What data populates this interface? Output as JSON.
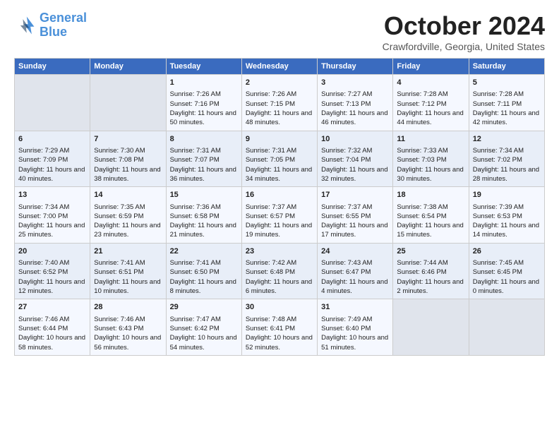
{
  "header": {
    "logo_line1": "General",
    "logo_line2": "Blue",
    "month": "October 2024",
    "location": "Crawfordville, Georgia, United States"
  },
  "days_of_week": [
    "Sunday",
    "Monday",
    "Tuesday",
    "Wednesday",
    "Thursday",
    "Friday",
    "Saturday"
  ],
  "weeks": [
    [
      {
        "day": "",
        "sunrise": "",
        "sunset": "",
        "daylight": ""
      },
      {
        "day": "",
        "sunrise": "",
        "sunset": "",
        "daylight": ""
      },
      {
        "day": "1",
        "sunrise": "Sunrise: 7:26 AM",
        "sunset": "Sunset: 7:16 PM",
        "daylight": "Daylight: 11 hours and 50 minutes."
      },
      {
        "day": "2",
        "sunrise": "Sunrise: 7:26 AM",
        "sunset": "Sunset: 7:15 PM",
        "daylight": "Daylight: 11 hours and 48 minutes."
      },
      {
        "day": "3",
        "sunrise": "Sunrise: 7:27 AM",
        "sunset": "Sunset: 7:13 PM",
        "daylight": "Daylight: 11 hours and 46 minutes."
      },
      {
        "day": "4",
        "sunrise": "Sunrise: 7:28 AM",
        "sunset": "Sunset: 7:12 PM",
        "daylight": "Daylight: 11 hours and 44 minutes."
      },
      {
        "day": "5",
        "sunrise": "Sunrise: 7:28 AM",
        "sunset": "Sunset: 7:11 PM",
        "daylight": "Daylight: 11 hours and 42 minutes."
      }
    ],
    [
      {
        "day": "6",
        "sunrise": "Sunrise: 7:29 AM",
        "sunset": "Sunset: 7:09 PM",
        "daylight": "Daylight: 11 hours and 40 minutes."
      },
      {
        "day": "7",
        "sunrise": "Sunrise: 7:30 AM",
        "sunset": "Sunset: 7:08 PM",
        "daylight": "Daylight: 11 hours and 38 minutes."
      },
      {
        "day": "8",
        "sunrise": "Sunrise: 7:31 AM",
        "sunset": "Sunset: 7:07 PM",
        "daylight": "Daylight: 11 hours and 36 minutes."
      },
      {
        "day": "9",
        "sunrise": "Sunrise: 7:31 AM",
        "sunset": "Sunset: 7:05 PM",
        "daylight": "Daylight: 11 hours and 34 minutes."
      },
      {
        "day": "10",
        "sunrise": "Sunrise: 7:32 AM",
        "sunset": "Sunset: 7:04 PM",
        "daylight": "Daylight: 11 hours and 32 minutes."
      },
      {
        "day": "11",
        "sunrise": "Sunrise: 7:33 AM",
        "sunset": "Sunset: 7:03 PM",
        "daylight": "Daylight: 11 hours and 30 minutes."
      },
      {
        "day": "12",
        "sunrise": "Sunrise: 7:34 AM",
        "sunset": "Sunset: 7:02 PM",
        "daylight": "Daylight: 11 hours and 28 minutes."
      }
    ],
    [
      {
        "day": "13",
        "sunrise": "Sunrise: 7:34 AM",
        "sunset": "Sunset: 7:00 PM",
        "daylight": "Daylight: 11 hours and 25 minutes."
      },
      {
        "day": "14",
        "sunrise": "Sunrise: 7:35 AM",
        "sunset": "Sunset: 6:59 PM",
        "daylight": "Daylight: 11 hours and 23 minutes."
      },
      {
        "day": "15",
        "sunrise": "Sunrise: 7:36 AM",
        "sunset": "Sunset: 6:58 PM",
        "daylight": "Daylight: 11 hours and 21 minutes."
      },
      {
        "day": "16",
        "sunrise": "Sunrise: 7:37 AM",
        "sunset": "Sunset: 6:57 PM",
        "daylight": "Daylight: 11 hours and 19 minutes."
      },
      {
        "day": "17",
        "sunrise": "Sunrise: 7:37 AM",
        "sunset": "Sunset: 6:55 PM",
        "daylight": "Daylight: 11 hours and 17 minutes."
      },
      {
        "day": "18",
        "sunrise": "Sunrise: 7:38 AM",
        "sunset": "Sunset: 6:54 PM",
        "daylight": "Daylight: 11 hours and 15 minutes."
      },
      {
        "day": "19",
        "sunrise": "Sunrise: 7:39 AM",
        "sunset": "Sunset: 6:53 PM",
        "daylight": "Daylight: 11 hours and 14 minutes."
      }
    ],
    [
      {
        "day": "20",
        "sunrise": "Sunrise: 7:40 AM",
        "sunset": "Sunset: 6:52 PM",
        "daylight": "Daylight: 11 hours and 12 minutes."
      },
      {
        "day": "21",
        "sunrise": "Sunrise: 7:41 AM",
        "sunset": "Sunset: 6:51 PM",
        "daylight": "Daylight: 11 hours and 10 minutes."
      },
      {
        "day": "22",
        "sunrise": "Sunrise: 7:41 AM",
        "sunset": "Sunset: 6:50 PM",
        "daylight": "Daylight: 11 hours and 8 minutes."
      },
      {
        "day": "23",
        "sunrise": "Sunrise: 7:42 AM",
        "sunset": "Sunset: 6:48 PM",
        "daylight": "Daylight: 11 hours and 6 minutes."
      },
      {
        "day": "24",
        "sunrise": "Sunrise: 7:43 AM",
        "sunset": "Sunset: 6:47 PM",
        "daylight": "Daylight: 11 hours and 4 minutes."
      },
      {
        "day": "25",
        "sunrise": "Sunrise: 7:44 AM",
        "sunset": "Sunset: 6:46 PM",
        "daylight": "Daylight: 11 hours and 2 minutes."
      },
      {
        "day": "26",
        "sunrise": "Sunrise: 7:45 AM",
        "sunset": "Sunset: 6:45 PM",
        "daylight": "Daylight: 11 hours and 0 minutes."
      }
    ],
    [
      {
        "day": "27",
        "sunrise": "Sunrise: 7:46 AM",
        "sunset": "Sunset: 6:44 PM",
        "daylight": "Daylight: 10 hours and 58 minutes."
      },
      {
        "day": "28",
        "sunrise": "Sunrise: 7:46 AM",
        "sunset": "Sunset: 6:43 PM",
        "daylight": "Daylight: 10 hours and 56 minutes."
      },
      {
        "day": "29",
        "sunrise": "Sunrise: 7:47 AM",
        "sunset": "Sunset: 6:42 PM",
        "daylight": "Daylight: 10 hours and 54 minutes."
      },
      {
        "day": "30",
        "sunrise": "Sunrise: 7:48 AM",
        "sunset": "Sunset: 6:41 PM",
        "daylight": "Daylight: 10 hours and 52 minutes."
      },
      {
        "day": "31",
        "sunrise": "Sunrise: 7:49 AM",
        "sunset": "Sunset: 6:40 PM",
        "daylight": "Daylight: 10 hours and 51 minutes."
      },
      {
        "day": "",
        "sunrise": "",
        "sunset": "",
        "daylight": ""
      },
      {
        "day": "",
        "sunrise": "",
        "sunset": "",
        "daylight": ""
      }
    ]
  ]
}
